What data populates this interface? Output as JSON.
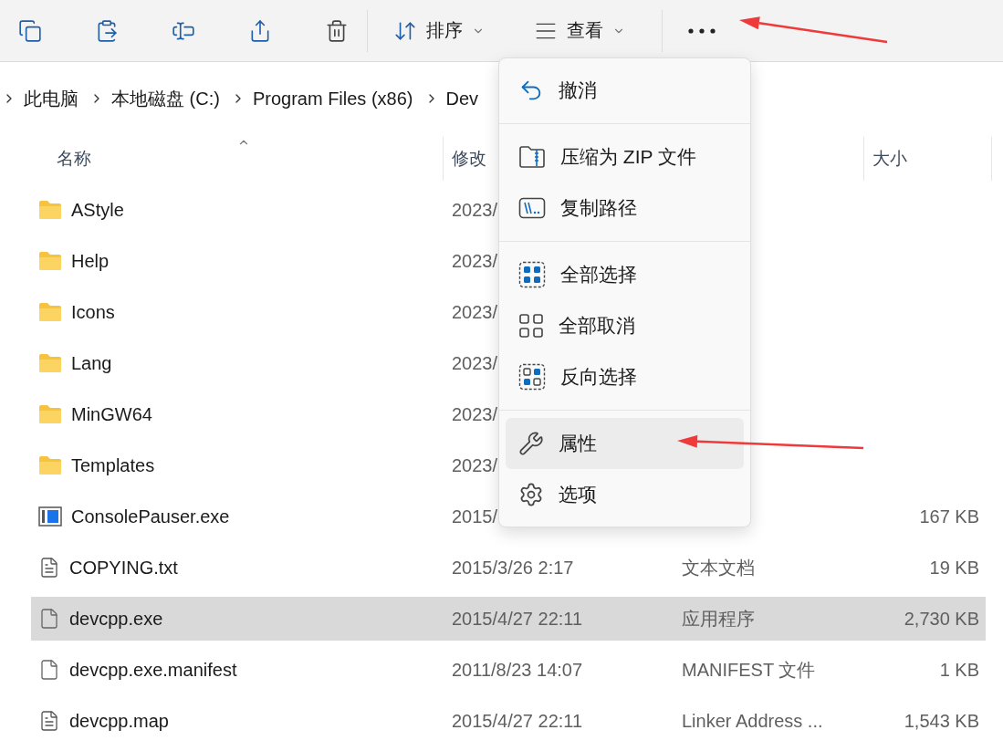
{
  "toolbar": {
    "icon_buttons": [
      {
        "kind": "copy"
      },
      {
        "kind": "paste"
      },
      {
        "kind": "rename"
      },
      {
        "kind": "share"
      },
      {
        "kind": "delete"
      }
    ],
    "menus": [
      {
        "kind": "sort",
        "label": "排序"
      },
      {
        "kind": "view",
        "label": "查看"
      }
    ],
    "more": {
      "kind": "more"
    }
  },
  "breadcrumb": [
    "此电脑",
    "本地磁盘 (C:)",
    "Program Files (x86)",
    "Dev"
  ],
  "table": {
    "columns": [
      {
        "label": "名称",
        "sorted": true
      },
      {
        "label": "修改"
      },
      {},
      {
        "label": "大小"
      }
    ],
    "rows": [
      {
        "kind": "folder",
        "name": "AStyle",
        "date": "2023/",
        "selected": false
      },
      {
        "kind": "folder",
        "name": "Help",
        "date": "2023/",
        "selected": false
      },
      {
        "kind": "folder",
        "name": "Icons",
        "date": "2023/",
        "selected": false
      },
      {
        "kind": "folder",
        "name": "Lang",
        "date": "2023/",
        "selected": false
      },
      {
        "kind": "folder",
        "name": "MinGW64",
        "date": "2023/",
        "selected": false
      },
      {
        "kind": "folder",
        "name": "Templates",
        "date": "2023/",
        "selected": false
      },
      {
        "kind": "app",
        "name": "ConsolePauser.exe",
        "date": "2015/",
        "size": "167 KB",
        "selected": false
      },
      {
        "kind": "text",
        "name": "COPYING.txt",
        "date": "2015/3/26 2:17",
        "type": "文本文档",
        "size": "19 KB",
        "selected": false
      },
      {
        "kind": "file",
        "name": "devcpp.exe",
        "date": "2015/4/27 22:11",
        "type": "应用程序",
        "size": "2,730 KB",
        "selected": true
      },
      {
        "kind": "file",
        "name": "devcpp.exe.manifest",
        "date": "2011/8/23 14:07",
        "type": "MANIFEST 文件",
        "size": "1 KB",
        "selected": false
      },
      {
        "kind": "text",
        "name": "devcpp.map",
        "date": "2015/4/27 22:11",
        "type": "Linker Address ...",
        "size": "1,543 KB",
        "selected": false
      }
    ]
  },
  "context_menu": {
    "groups": [
      {
        "items": [
          {
            "kind": "undo",
            "label": "撤消",
            "highlighted": false
          }
        ]
      },
      {
        "items": [
          {
            "kind": "zip",
            "label": "压缩为 ZIP 文件",
            "highlighted": false
          },
          {
            "kind": "copypath",
            "label": "复制路径",
            "highlighted": false
          }
        ]
      },
      {
        "items": [
          {
            "kind": "selectall",
            "label": "全部选择",
            "highlighted": false
          },
          {
            "kind": "selectnone",
            "label": "全部取消",
            "highlighted": false
          },
          {
            "kind": "invert",
            "label": "反向选择",
            "highlighted": false
          }
        ]
      },
      {
        "items": [
          {
            "kind": "properties",
            "label": "属性",
            "highlighted": true
          },
          {
            "kind": "options",
            "label": "选项",
            "highlighted": false
          }
        ]
      }
    ]
  },
  "annotations": [
    {
      "kind": "arrow"
    },
    {
      "kind": "arrow"
    }
  ]
}
